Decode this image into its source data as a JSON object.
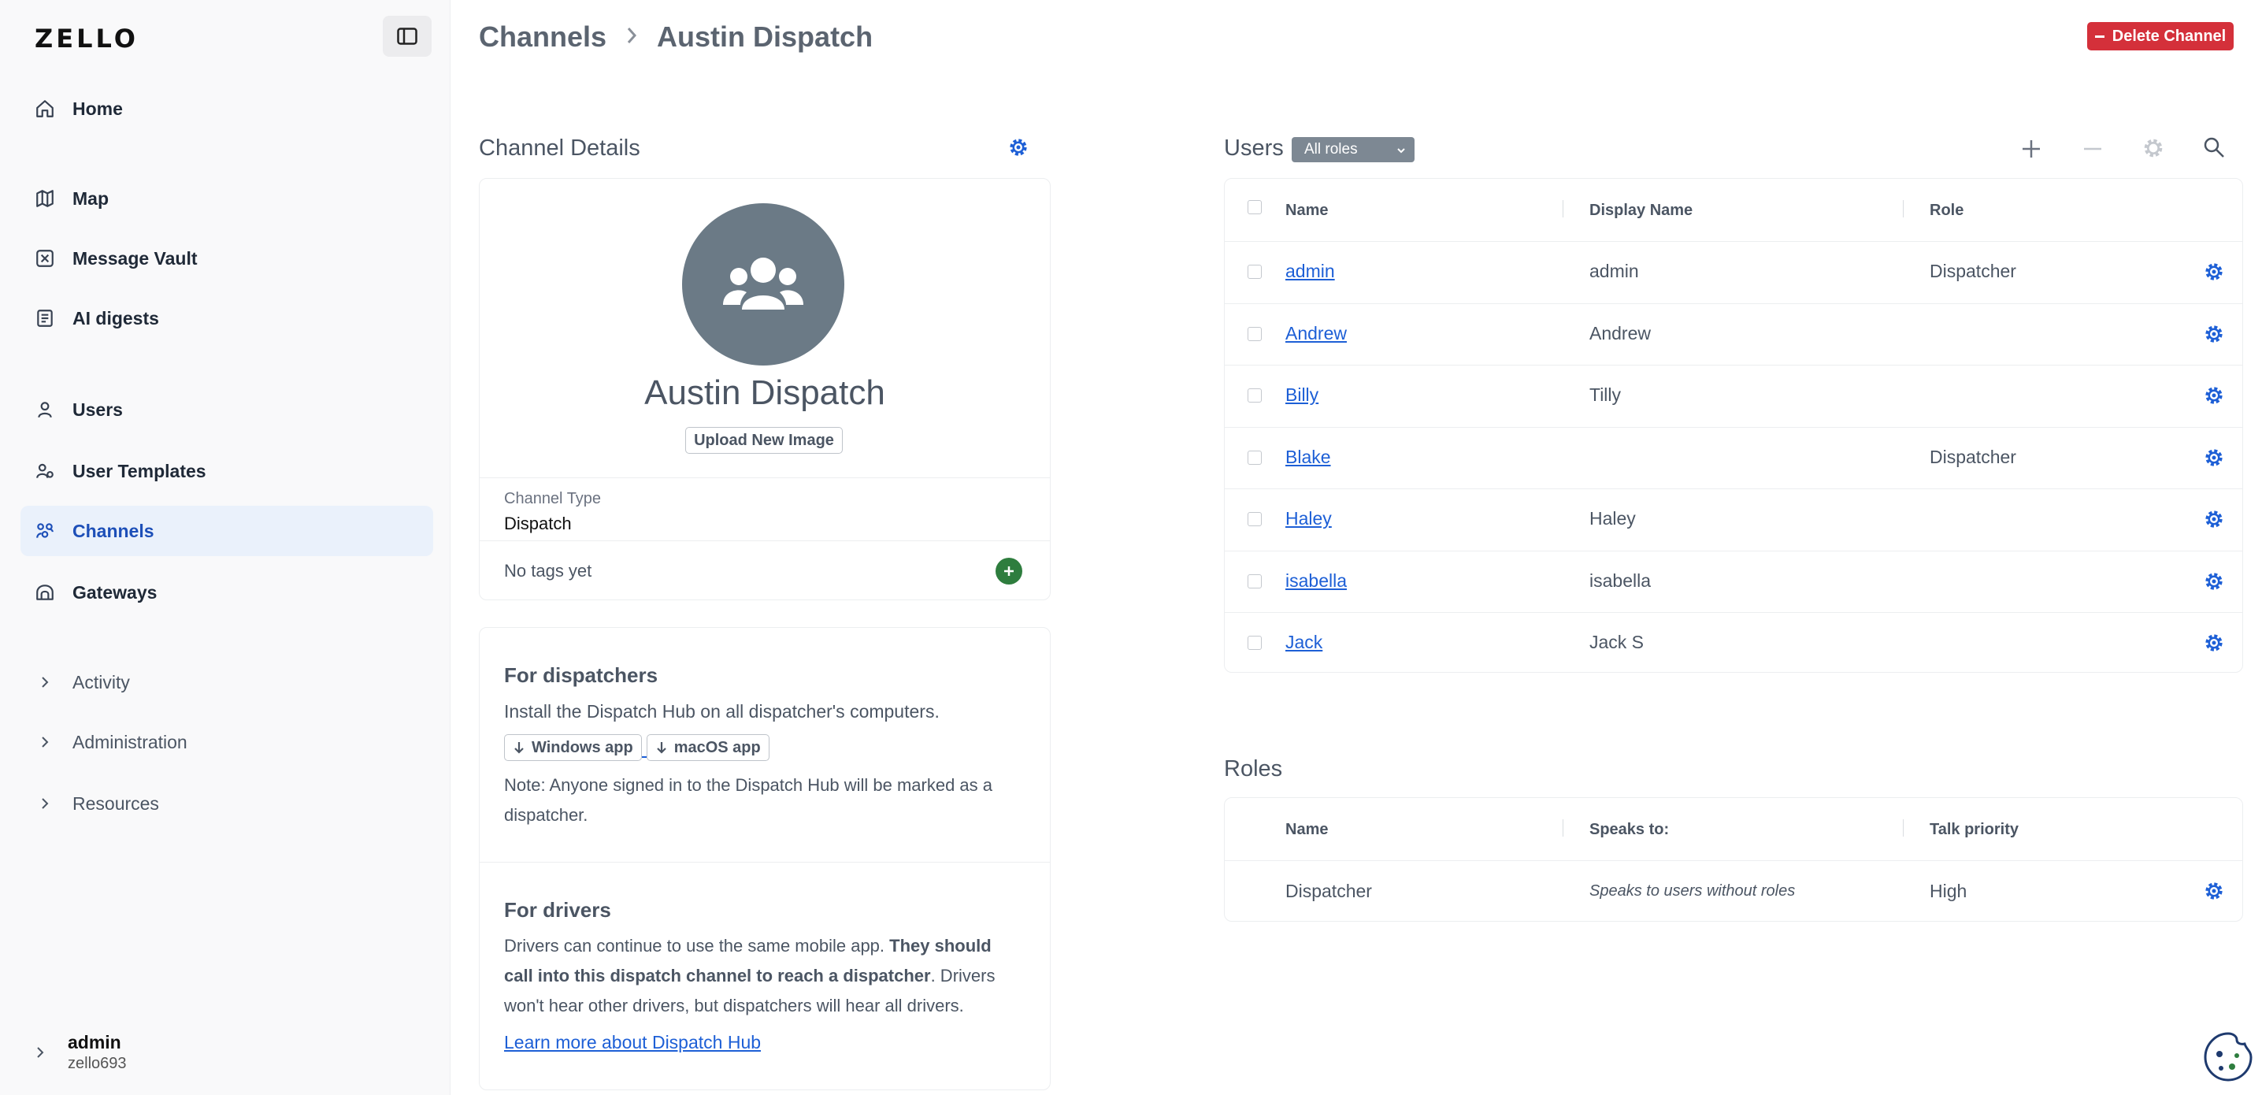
{
  "app": {
    "logo": "ZELLO"
  },
  "sidebar": {
    "items": [
      {
        "label": "Home",
        "icon": "home-icon"
      },
      {
        "label": "Map",
        "icon": "map-icon"
      },
      {
        "label": "Message Vault",
        "icon": "vault-icon"
      },
      {
        "label": "AI digests",
        "icon": "digest-icon"
      },
      {
        "label": "Users",
        "icon": "user-icon"
      },
      {
        "label": "User Templates",
        "icon": "template-icon"
      },
      {
        "label": "Channels",
        "icon": "channels-icon",
        "active": true
      },
      {
        "label": "Gateways",
        "icon": "gateway-icon"
      }
    ],
    "groups": [
      {
        "label": "Activity"
      },
      {
        "label": "Administration"
      },
      {
        "label": "Resources"
      }
    ],
    "user": {
      "name": "admin",
      "org": "zello693"
    }
  },
  "header": {
    "breadcrumb": [
      "Channels",
      "Austin Dispatch"
    ],
    "delete_label": "Delete Channel"
  },
  "channel_details": {
    "title": "Channel Details",
    "name": "Austin Dispatch",
    "upload_label": "Upload New Image",
    "type_label": "Channel Type",
    "type_value": "Dispatch",
    "tags_text": "No tags yet"
  },
  "dispatchers": {
    "title": "For dispatchers",
    "text": "Install the Dispatch Hub on all dispatcher's computers.",
    "windows_label": "Windows app",
    "mac_label": "macOS app",
    "note_line1": "Note: Anyone signed in to the Dispatch Hub will be marked as a",
    "note_line2": "dispatcher."
  },
  "drivers": {
    "title": "For drivers",
    "line1_plain": "Drivers can continue to use the same mobile app. ",
    "line1_bold": "They should",
    "line2_bold": "call into this dispatch channel to reach a dispatcher",
    "line2_plain": ". Drivers",
    "line3": "won't hear other drivers, but dispatchers will hear all drivers.",
    "link": "Learn more about Dispatch Hub"
  },
  "users": {
    "title": "Users",
    "filter": "All roles",
    "columns": [
      "Name",
      "Display Name",
      "Role"
    ],
    "rows": [
      {
        "name": "admin",
        "display": "admin",
        "role": "Dispatcher"
      },
      {
        "name": "Andrew",
        "display": "Andrew",
        "role": ""
      },
      {
        "name": "Billy",
        "display": "Tilly",
        "role": ""
      },
      {
        "name": "Blake",
        "display": "",
        "role": "Dispatcher"
      },
      {
        "name": "Haley",
        "display": "Haley",
        "role": ""
      },
      {
        "name": "isabella",
        "display": "isabella",
        "role": ""
      },
      {
        "name": "Jack",
        "display": "Jack S",
        "role": ""
      }
    ]
  },
  "roles": {
    "title": "Roles",
    "columns": [
      "Name",
      "Speaks to:",
      "Talk priority"
    ],
    "rows": [
      {
        "name": "Dispatcher",
        "speaks_to": "Speaks to users without roles",
        "priority": "High"
      }
    ]
  },
  "colors": {
    "accent": "#1d5fd6",
    "danger": "#d4303a",
    "add_green": "#2e7d3e",
    "active_bg": "#eaf1fb"
  }
}
